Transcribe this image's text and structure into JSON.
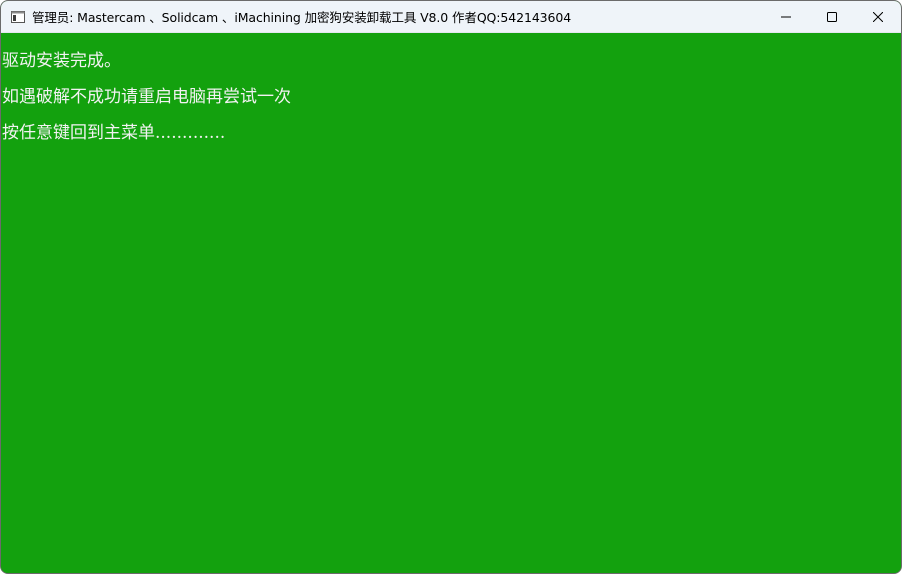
{
  "window": {
    "title": "管理员:  Mastercam 、Solidcam 、iMachining 加密狗安装卸载工具 V8.0  作者QQ:542143604",
    "app_icon": "console-app-icon",
    "controls": {
      "minimize_icon": "minimize-icon",
      "maximize_icon": "maximize-icon",
      "close_icon": "close-icon"
    }
  },
  "console": {
    "background": "#13a10e",
    "text_color": "#f2f2f2",
    "lines": [
      "驱动安装完成。",
      "如遇破解不成功请重启电脑再尝试一次",
      "按任意键回到主菜单............."
    ]
  }
}
